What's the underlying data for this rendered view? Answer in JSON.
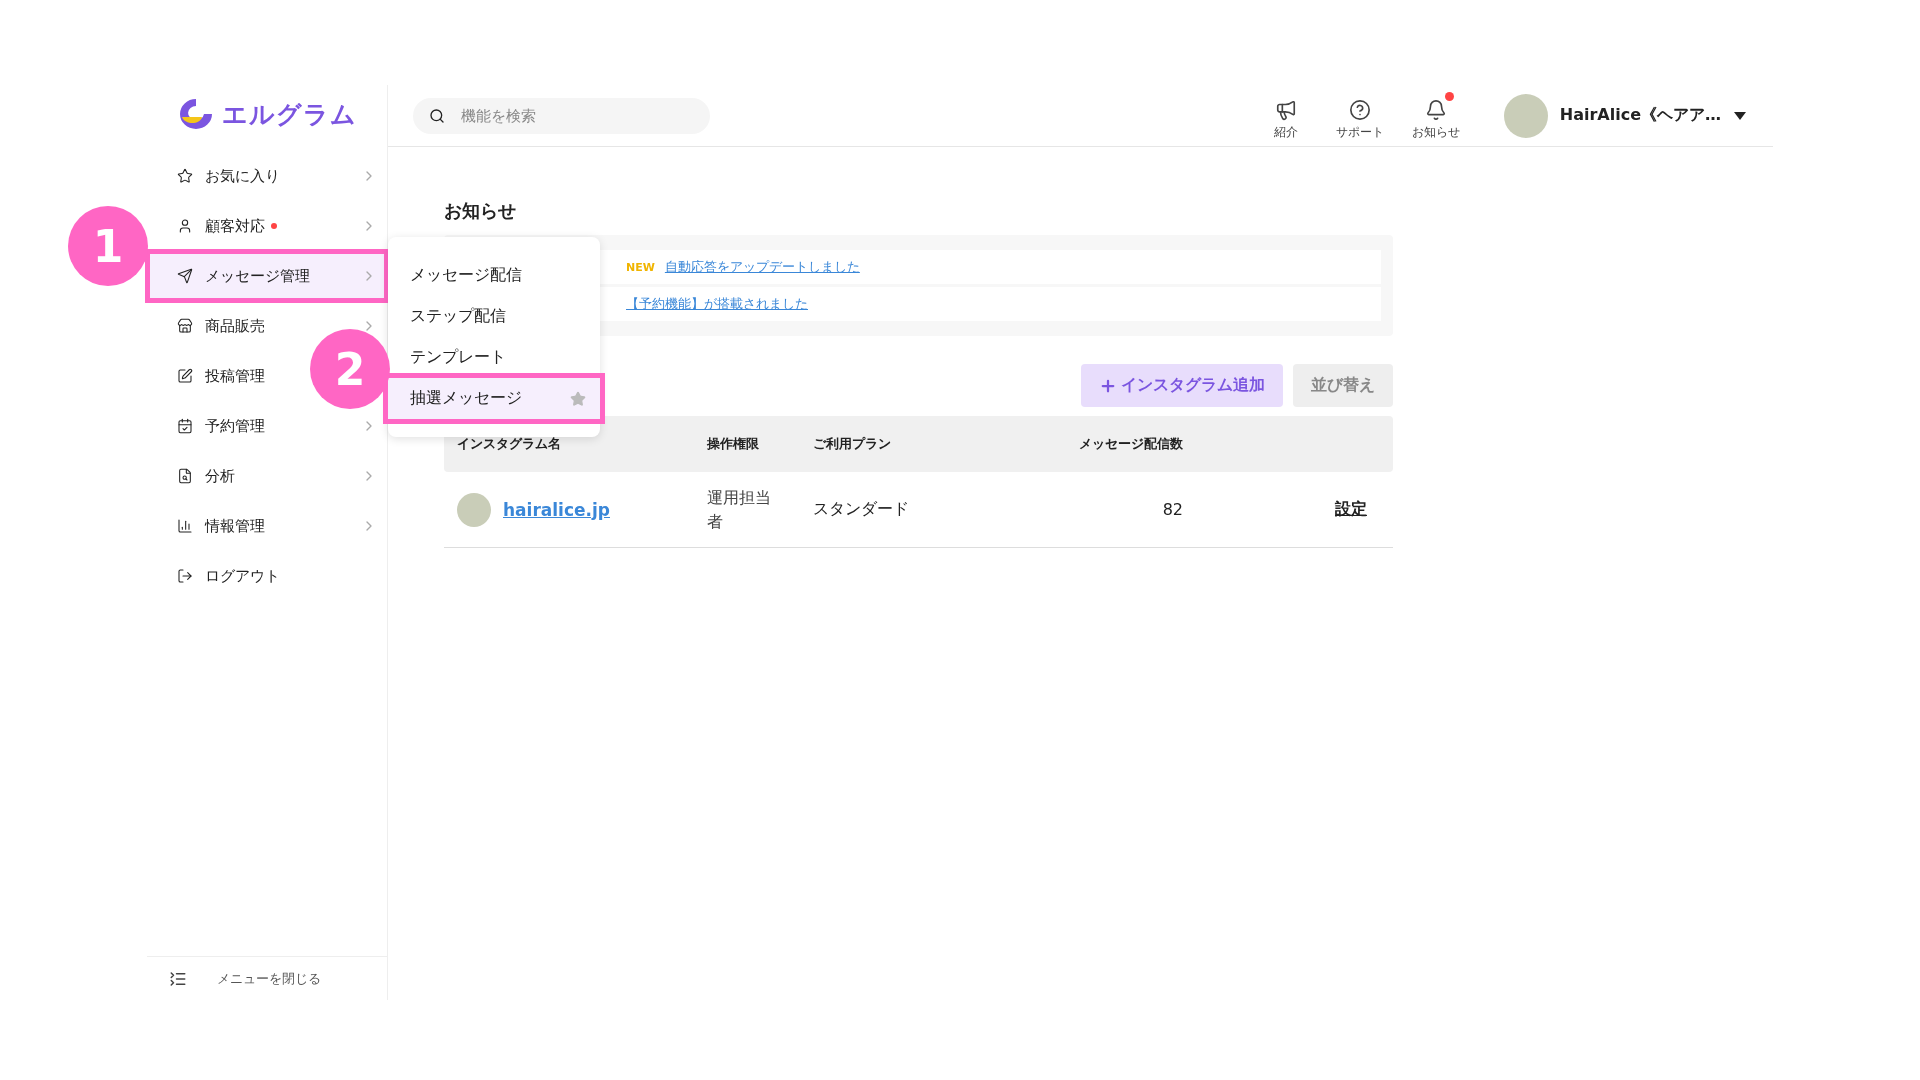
{
  "logo": {
    "text": "エルグラム"
  },
  "search": {
    "placeholder": "機能を検索"
  },
  "header_icons": [
    {
      "label": "紹介",
      "badge": false
    },
    {
      "label": "サポート",
      "badge": false
    },
    {
      "label": "お知らせ",
      "badge": true
    }
  ],
  "account": {
    "name": "HairAlice《ヘアア…"
  },
  "sidebar": {
    "items": [
      {
        "label": "お気に入り",
        "badge": false,
        "selected": false,
        "highlighted": false,
        "chevron": true
      },
      {
        "label": "顧客対応",
        "badge": true,
        "selected": false,
        "highlighted": false,
        "chevron": true
      },
      {
        "label": "メッセージ管理",
        "badge": false,
        "selected": true,
        "highlighted": true,
        "chevron": true
      },
      {
        "label": "商品販売",
        "badge": false,
        "selected": false,
        "highlighted": false,
        "chevron": true
      },
      {
        "label": "投稿管理",
        "badge": false,
        "selected": false,
        "highlighted": false
      },
      {
        "label": "予約管理",
        "badge": false,
        "selected": false,
        "highlighted": false,
        "chevron": true
      },
      {
        "label": "分析",
        "badge": false,
        "selected": false,
        "highlighted": false,
        "chevron": true
      },
      {
        "label": "情報管理",
        "badge": false,
        "selected": false,
        "highlighted": false,
        "chevron": true
      },
      {
        "label": "ログアウト",
        "badge": false,
        "selected": false,
        "highlighted": false,
        "chevron": false
      }
    ],
    "collapse": "メニューを閉じる"
  },
  "submenu": {
    "items": [
      {
        "label": "メッセージ配信",
        "selected": false,
        "highlighted": false
      },
      {
        "label": "ステップ配信",
        "selected": false,
        "highlighted": false
      },
      {
        "label": "テンプレート",
        "selected": false,
        "highlighted": false
      },
      {
        "label": "抽選メッセージ",
        "selected": true,
        "highlighted": true
      }
    ]
  },
  "annotations": [
    {
      "label": "1"
    },
    {
      "label": "2"
    }
  ],
  "notices": {
    "title": "お知らせ",
    "items": [
      {
        "badge": "NEW",
        "text": "自動応答をアップデートしました"
      },
      {
        "text": "【予約機能】が搭載されました"
      }
    ]
  },
  "actions": [
    {
      "label": "インスタグラム追加",
      "kind": "primary"
    },
    {
      "label": "並び替え",
      "kind": "secondary"
    }
  ],
  "table": {
    "columns": [
      "インスタグラム名",
      "操作権限",
      "ご利用プラン",
      "メッセージ配信数"
    ],
    "rows": [
      {
        "account": "hairalice.jp",
        "role": "運用担当者",
        "plan": "スタンダード",
        "messages": "82",
        "action": "設定"
      }
    ]
  }
}
